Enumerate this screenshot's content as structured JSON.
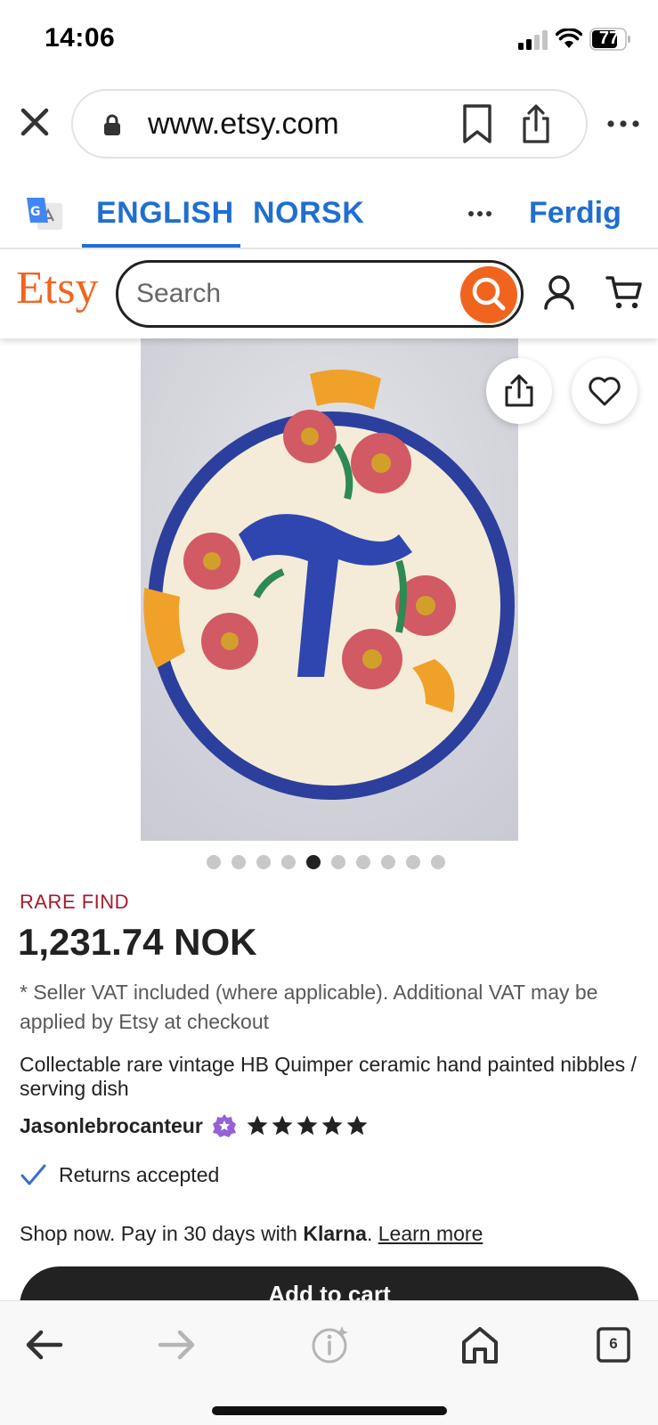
{
  "status_bar": {
    "time": "14:06",
    "battery": "77"
  },
  "browser": {
    "url": "www.etsy.com",
    "icons": [
      "close-icon",
      "lock-icon",
      "bookmark-icon",
      "share-icon",
      "more-icon"
    ]
  },
  "translate_bar": {
    "languages": [
      "ENGLISH",
      "NORSK"
    ],
    "selected": "ENGLISH",
    "done_label": "Ferdig"
  },
  "etsy_header": {
    "logo": "Etsy",
    "search_placeholder": "Search"
  },
  "gallery": {
    "image_count": 10,
    "active_index": 4
  },
  "product": {
    "badge": "RARE FIND",
    "price": "1,231.74 NOK",
    "vat_note": "* Seller VAT included (where applicable). Additional VAT may be applied by Etsy at checkout",
    "title": "Collectable rare vintage HB Quimper ceramic hand painted nibbles / serving dish",
    "seller": "Jasonlebrocanteur",
    "rating": 5,
    "returns": "Returns accepted",
    "klarna_prefix": "Shop now. Pay in 30 days with ",
    "klarna_brand": "Klarna",
    "klarna_suffix": ". ",
    "learn_more": "Learn more",
    "add_to_cart": "Add to cart"
  },
  "toolbar": {
    "tabs_count": "6"
  },
  "colors": {
    "etsy_orange": "#f1641e",
    "translate_blue": "#1f6fd1",
    "rare_find_red": "#a61a2e",
    "star_seller_purple": "#9560d8"
  }
}
